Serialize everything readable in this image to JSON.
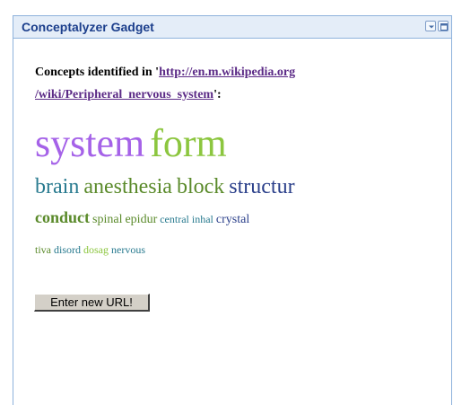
{
  "gadget": {
    "title": "Conceptalyzer Gadget"
  },
  "intro": {
    "prefix": "Concepts identified in '",
    "url_line1": "http://en.m.wikipedia.org",
    "url_line2": "/wiki/Peripheral_nervous_system",
    "suffix": "':"
  },
  "cloud": {
    "rows": [
      [
        {
          "word": "system",
          "color": "#a562e8",
          "size": "xl"
        },
        {
          "word": "form",
          "color": "#8cc63f",
          "size": "xl"
        }
      ],
      [
        {
          "word": "brain",
          "color": "#287a8f",
          "size": "l"
        },
        {
          "word": "anesthesia",
          "color": "#5a8a2a",
          "size": "l"
        },
        {
          "word": "block",
          "color": "#5a8a2a",
          "size": "l"
        },
        {
          "word": "structur",
          "color": "#2a3f8a",
          "size": "l"
        }
      ],
      [
        {
          "word": "conduct",
          "color": "#5a8a2a",
          "size": "m"
        },
        {
          "word": "spinal",
          "color": "#5a8a2a",
          "size": "s"
        },
        {
          "word": "epidur",
          "color": "#5a8a2a",
          "size": "s"
        },
        {
          "word": "central",
          "color": "#287a8f",
          "size": "xs"
        },
        {
          "word": "inhal",
          "color": "#287a8f",
          "size": "xs"
        },
        {
          "word": "crystal",
          "color": "#2a3f8a",
          "size": "s"
        }
      ],
      [
        {
          "word": "tiva",
          "color": "#5a8a2a",
          "size": "xs"
        },
        {
          "word": "disord",
          "color": "#287a8f",
          "size": "xs"
        },
        {
          "word": "dosag",
          "color": "#8cc63f",
          "size": "xs"
        },
        {
          "word": "nervous",
          "color": "#287a8f",
          "size": "xs"
        }
      ]
    ]
  },
  "button": {
    "label": "Enter new URL!"
  },
  "icons": {
    "minimize": "minimize-icon",
    "maximize": "maximize-icon"
  }
}
